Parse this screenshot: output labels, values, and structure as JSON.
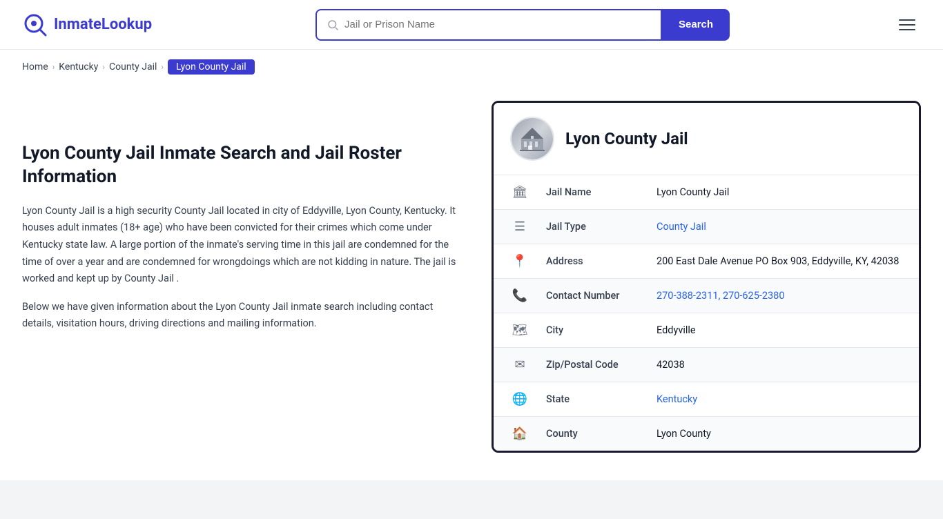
{
  "logo": {
    "text_part1": "Inmate",
    "text_part2": "Lookup"
  },
  "search": {
    "placeholder": "Jail or Prison Name",
    "button_label": "Search"
  },
  "breadcrumb": {
    "items": [
      {
        "label": "Home",
        "href": "#"
      },
      {
        "label": "Kentucky",
        "href": "#"
      },
      {
        "label": "County Jail",
        "href": "#"
      },
      {
        "label": "Lyon County Jail",
        "active": true
      }
    ]
  },
  "main": {
    "left": {
      "title": "Lyon County Jail Inmate Search and Jail Roster Information",
      "description1": "Lyon County Jail is a high security County Jail located in city of Eddyville, Lyon County, Kentucky. It houses adult inmates (18+ age) who have been convicted for their crimes which come under Kentucky state law. A large portion of the inmate's serving time in this jail are condemned for the time of over a year and are condemned for wrongdoings which are not kidding in nature. The jail is worked and kept up by County Jail .",
      "description2": "Below we have given information about the Lyon County Jail inmate search including contact details, visitation hours, driving directions and mailing information."
    },
    "card": {
      "title": "Lyon County Jail",
      "fields": [
        {
          "icon": "jail-icon",
          "label": "Jail Name",
          "value": "Lyon County Jail",
          "link": null
        },
        {
          "icon": "type-icon",
          "label": "Jail Type",
          "value": "County Jail",
          "link": "#"
        },
        {
          "icon": "address-icon",
          "label": "Address",
          "value": "200 East Dale Avenue PO Box 903, Eddyville, KY, 42038",
          "link": null
        },
        {
          "icon": "phone-icon",
          "label": "Contact Number",
          "value": "270-388-2311, 270-625-2380",
          "link": "#"
        },
        {
          "icon": "city-icon",
          "label": "City",
          "value": "Eddyville",
          "link": null
        },
        {
          "icon": "zip-icon",
          "label": "Zip/Postal Code",
          "value": "42038",
          "link": null
        },
        {
          "icon": "state-icon",
          "label": "State",
          "value": "Kentucky",
          "link": "#"
        },
        {
          "icon": "county-icon",
          "label": "County",
          "value": "Lyon County",
          "link": null
        }
      ]
    }
  }
}
